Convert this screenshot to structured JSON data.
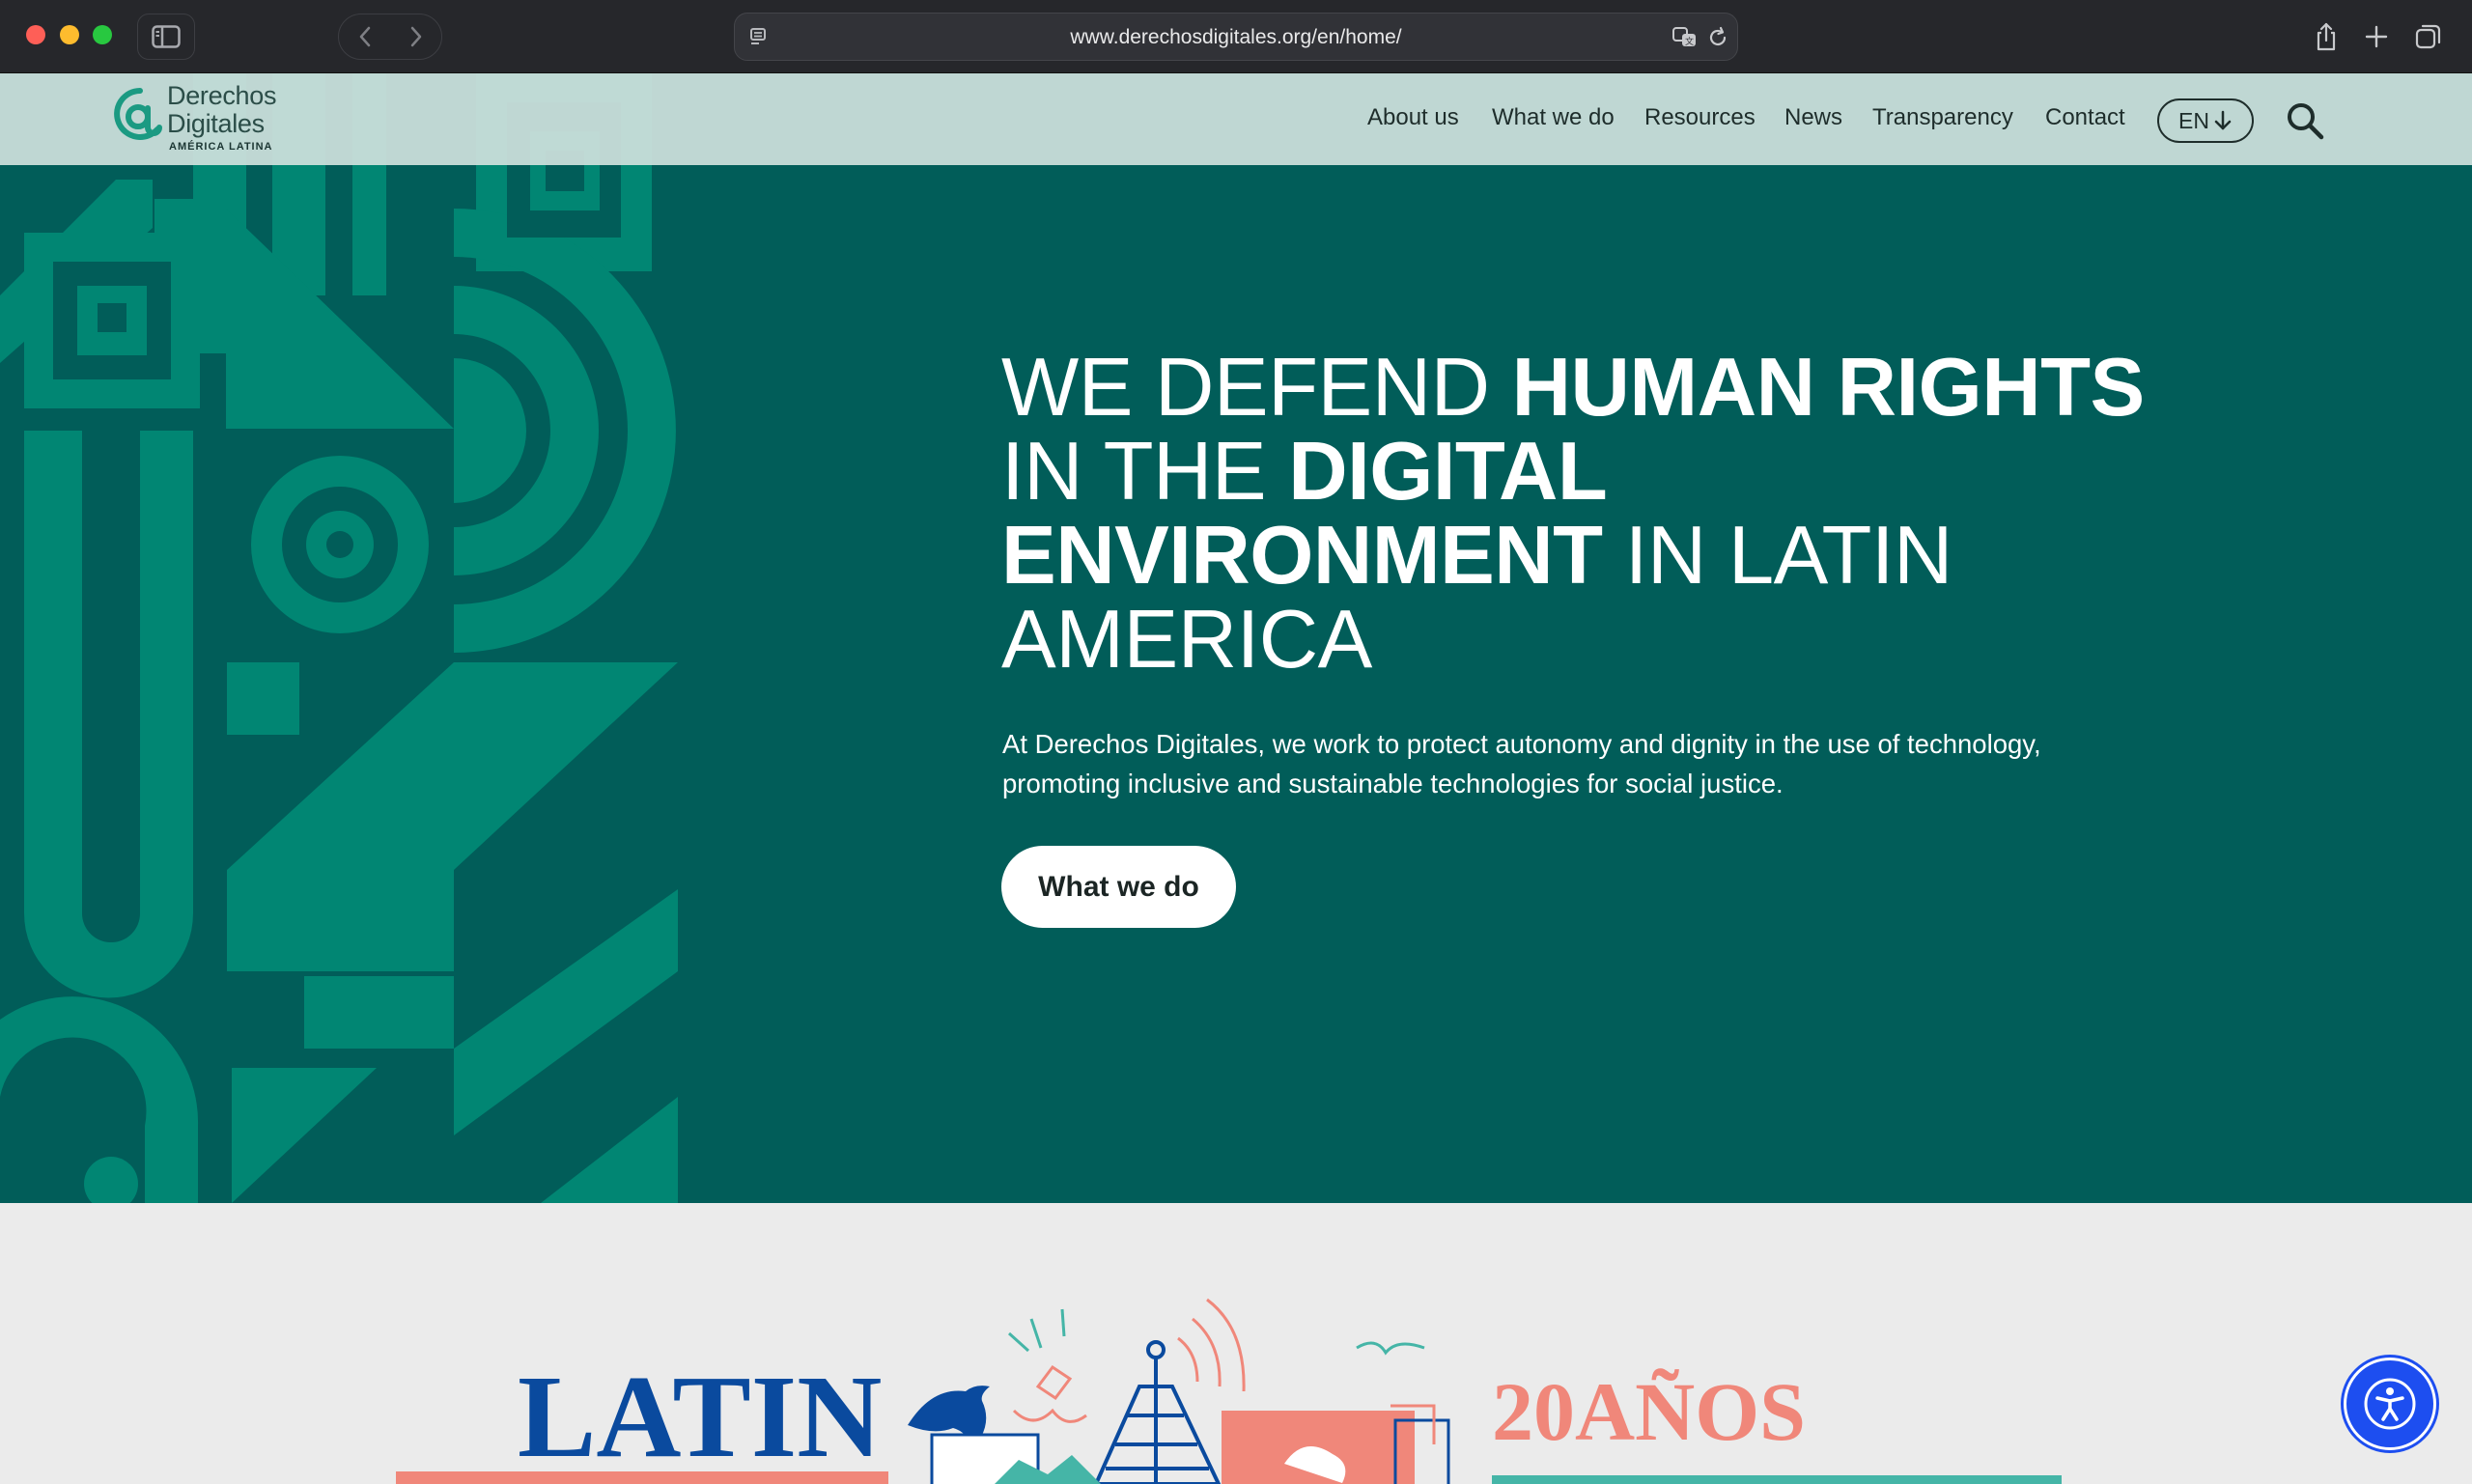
{
  "browser": {
    "url": "www.derechosdigitales.org/en/home/"
  },
  "site": {
    "logo": {
      "line1": "Derechos",
      "line2": "Digitales",
      "sub": "AMÉRICA LATINA"
    },
    "nav": [
      {
        "label": "About us"
      },
      {
        "label": "What we do"
      },
      {
        "label": "Resources"
      },
      {
        "label": "News"
      },
      {
        "label": "Transparency"
      },
      {
        "label": "Contact"
      }
    ],
    "language": "EN"
  },
  "hero": {
    "title": {
      "p1": "We defend ",
      "b1": "human rights",
      "p2": " in the ",
      "b2": "digital environment",
      "p3": " in Latin America"
    },
    "text": "At Derechos Digitales, we work to protect autonomy and dignity in the use of technology, promoting inclusive and sustainable technologies for social justice.",
    "cta": "What we do"
  },
  "banner": {
    "left_word": "LATIN",
    "right_word": "20AÑOS",
    "colors": {
      "blue": "#0a4a9e",
      "coral": "#f0877a",
      "teal": "#45b5a7"
    }
  },
  "colors": {
    "hero_bg": "#015d59",
    "pattern": "#018673",
    "header_bg": "#cde1dd",
    "accessibility": "#1d4ef0"
  }
}
